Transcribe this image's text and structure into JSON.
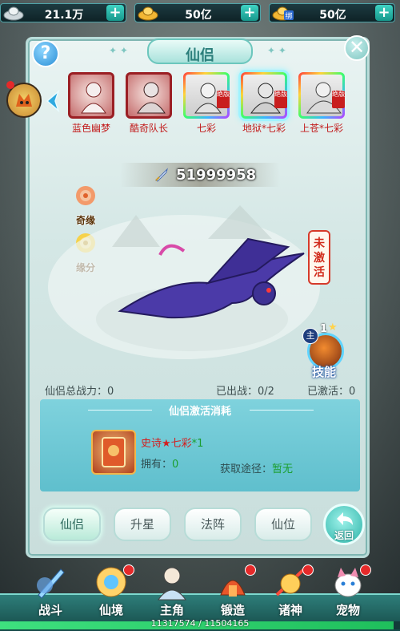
{
  "currencies": [
    {
      "icon": "silver-ingot-icon",
      "value": "21.1万"
    },
    {
      "icon": "gold-ingot-icon",
      "value": "50亿"
    },
    {
      "icon": "bound-gold-ingot-icon",
      "value": "50亿",
      "badge": "绑"
    }
  ],
  "panel": {
    "title": "仙侣",
    "help_glyph": "?",
    "close_glyph": "✕"
  },
  "companions": [
    {
      "name": "蓝色幽梦",
      "frame": "red",
      "tag": ""
    },
    {
      "name": "酷奇队长",
      "frame": "red",
      "tag": ""
    },
    {
      "name": "七彩",
      "frame": "rainbow",
      "tag": "绝版"
    },
    {
      "name": "地狱*七彩",
      "frame": "rainbow",
      "tag": "绝版",
      "selected": true
    },
    {
      "name": "上苍*七彩",
      "frame": "rainbow",
      "tag": "绝版"
    }
  ],
  "power": "51999958",
  "side_buttons": {
    "qiyuan": "奇缘",
    "yuanfen": "缘分"
  },
  "status": "未激活",
  "skill": {
    "main": "主",
    "level": "1",
    "label": "技能"
  },
  "stats": {
    "total_power": "仙侣总战力：0",
    "deployed": "已出战：0/2",
    "activated": "已激活：0"
  },
  "activation_cost": {
    "title": "仙侣激活消耗",
    "item_name": "史诗★七彩",
    "item_qty": "*1",
    "own_label": "拥有：",
    "own_value": "0",
    "source_label": "获取途径：",
    "source_value": "暂无"
  },
  "tabs": [
    "仙侣",
    "升星",
    "法阵",
    "仙位"
  ],
  "back_label": "返回",
  "bottom_nav": [
    {
      "label": "战斗",
      "dot": false
    },
    {
      "label": "仙境",
      "dot": true
    },
    {
      "label": "主角",
      "dot": false
    },
    {
      "label": "锻造",
      "dot": true
    },
    {
      "label": "诸神",
      "dot": true
    },
    {
      "label": "宠物",
      "dot": true
    }
  ],
  "experience": {
    "text": "11317574 / 11504165",
    "fraction": 0.984
  },
  "colors": {
    "accent": "#3fd3c4",
    "alert": "#d12b1c",
    "positive": "#1b9e2f"
  }
}
